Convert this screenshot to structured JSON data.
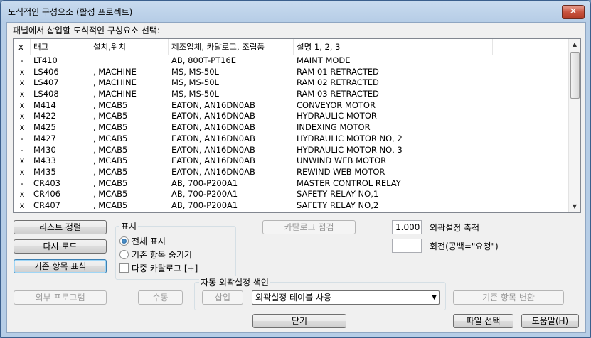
{
  "window": {
    "title": "도식적인 구성요소 (활성 프로젝트)",
    "close_glyph": "✕"
  },
  "prompt": "패널에서 삽입할 도식적인 구성요소 선택:",
  "list": {
    "columns": [
      "x",
      "태그",
      "설치,위치",
      "제조업체, 카탈로그, 조립품",
      "설명 1, 2, 3"
    ],
    "rows": [
      [
        "-",
        "LT410",
        "",
        "AB, 800T-PT16E",
        "MAINT MODE"
      ],
      [
        "x",
        "LS406",
        ", MACHINE",
        "MS, MS-50L",
        "RAM 01 RETRACTED"
      ],
      [
        "x",
        "LS407",
        ", MACHINE",
        "MS, MS-50L",
        "RAM 02 RETRACTED"
      ],
      [
        "x",
        "LS408",
        ", MACHINE",
        "MS, MS-50L",
        "RAM 03 RETRACTED"
      ],
      [
        "x",
        "M414",
        ", MCAB5",
        "EATON, AN16DN0AB",
        "CONVEYOR MOTOR"
      ],
      [
        "x",
        "M422",
        ", MCAB5",
        "EATON, AN16DN0AB",
        "HYDRAULIC MOTOR"
      ],
      [
        "x",
        "M425",
        ", MCAB5",
        "EATON, AN16DN0AB",
        "INDEXING MOTOR"
      ],
      [
        "-",
        "M427",
        ", MCAB5",
        "EATON, AN16DN0AB",
        "HYDRAULIC MOTOR NO, 2"
      ],
      [
        "-",
        "M430",
        ", MCAB5",
        "EATON, AN16DN0AB",
        "HYDRAULIC MOTOR NO, 3"
      ],
      [
        "x",
        "M433",
        ", MCAB5",
        "EATON, AN16DN0AB",
        "UNWIND WEB MOTOR"
      ],
      [
        "x",
        "M435",
        ", MCAB5",
        "EATON, AN16DN0AB",
        "REWIND WEB MOTOR"
      ],
      [
        "-",
        "CR403",
        ", MCAB5",
        "AB, 700-P200A1",
        "MASTER CONTROL RELAY"
      ],
      [
        "x",
        "CR406",
        ", MCAB5",
        "AB, 700-P200A1",
        "SAFETY RELAY NO,1"
      ],
      [
        "x",
        "CR407",
        ", MCAB5",
        "AB, 700-P200A1",
        "SAFETY RELAY NO,2"
      ]
    ]
  },
  "buttons": {
    "sort_list": "리스트 정렬",
    "reload": "다시 로드",
    "mark_existing": "기존 항목 표식",
    "catalog_check": "카탈로그 점검",
    "external_program": "외부 프로그램",
    "manual": "수동",
    "insert": "삽입",
    "convert_existing": "기존 항목 변환",
    "close": "닫기",
    "select_file": "파일 선택",
    "help": "도움말(H)"
  },
  "display_group": {
    "label": "표시",
    "show_all": "전체 표시",
    "hide_existing": "기존 항목 숨기기",
    "multi_catalog": "다중 카탈로그 [+]",
    "selected": "show_all"
  },
  "scale": {
    "value": "1.000",
    "label": "외곽설정 축척"
  },
  "rotation": {
    "value": "",
    "label": "회전(공백=\"요청\")"
  },
  "auto_footprint": {
    "label": "자동 외곽설정 색인",
    "combo_value": "외곽설정 테이블 사용"
  }
}
